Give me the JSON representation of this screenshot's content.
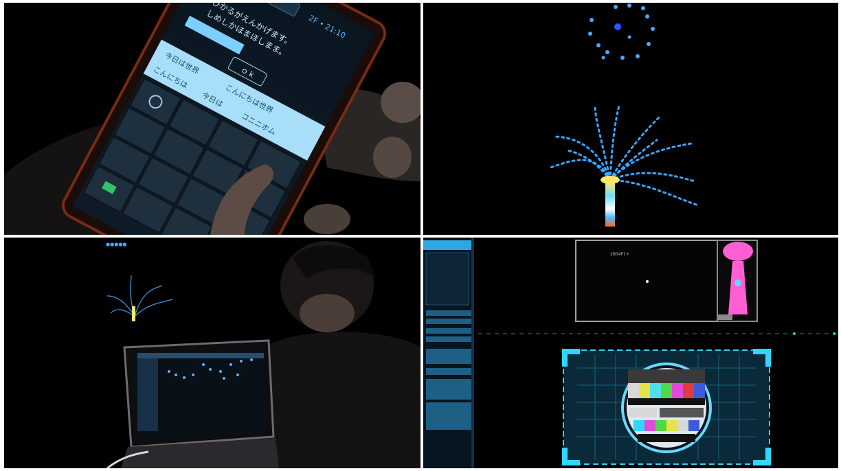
{
  "panels": [
    {
      "name": "phone-input-photo"
    },
    {
      "name": "light-fountain-photo"
    },
    {
      "name": "laptop-operator-photo"
    },
    {
      "name": "control-monitor-photo"
    }
  ],
  "phone": {
    "status_text": "2F • 21:10",
    "message_line1": "ひかるがえんかげます。",
    "message_line2": "しめしかほまほしまま。",
    "ok_label": "ｏｋ",
    "suggestions_row1": [
      "今日は世界",
      "こんにちは世界"
    ],
    "suggestions_row2": [
      "こんにちは",
      "今日は",
      "コニニホム"
    ]
  },
  "monitor": {
    "preview_caption": "2B04F1+",
    "sidebar_rows": 7
  },
  "colors": {
    "background": "#000000",
    "led_blue": "#3aa6ff",
    "screen_cyan": "#2fd7ff",
    "tower_pink": "#ff5fd2",
    "phone_keys": "#1e2f3e"
  }
}
